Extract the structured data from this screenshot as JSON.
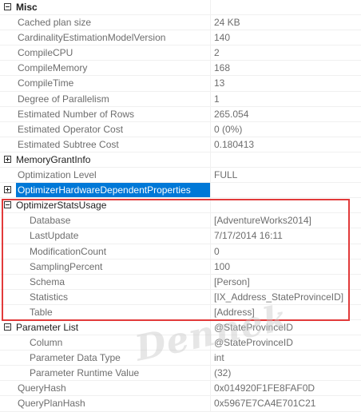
{
  "watermark": "Dennek",
  "rows": [
    {
      "kind": "category",
      "toggle": "minus",
      "name": "Misc",
      "value": ""
    },
    {
      "kind": "prop",
      "name": "Cached plan size",
      "value": "24 KB"
    },
    {
      "kind": "prop",
      "name": "CardinalityEstimationModelVersion",
      "value": "140"
    },
    {
      "kind": "prop",
      "name": "CompileCPU",
      "value": "2"
    },
    {
      "kind": "prop",
      "name": "CompileMemory",
      "value": "168"
    },
    {
      "kind": "prop",
      "name": "CompileTime",
      "value": "13"
    },
    {
      "kind": "prop",
      "name": "Degree of Parallelism",
      "value": "1"
    },
    {
      "kind": "prop",
      "name": "Estimated Number of Rows",
      "value": "265.054"
    },
    {
      "kind": "prop",
      "name": "Estimated Operator Cost",
      "value": "0 (0%)"
    },
    {
      "kind": "prop",
      "name": "Estimated Subtree Cost",
      "value": "0.180413"
    },
    {
      "kind": "group",
      "toggle": "plus",
      "name": "MemoryGrantInfo",
      "value": ""
    },
    {
      "kind": "prop",
      "name": "Optimization Level",
      "value": "FULL"
    },
    {
      "kind": "group",
      "toggle": "plus",
      "name": "OptimizerHardwareDependentProperties",
      "value": "",
      "selected": true
    },
    {
      "kind": "group",
      "toggle": "minus",
      "name": "OptimizerStatsUsage",
      "value": ""
    },
    {
      "kind": "child",
      "name": "Database",
      "value": "[AdventureWorks2014]"
    },
    {
      "kind": "child",
      "name": "LastUpdate",
      "value": "7/17/2014 16:11"
    },
    {
      "kind": "child",
      "name": "ModificationCount",
      "value": "0"
    },
    {
      "kind": "child",
      "name": "SamplingPercent",
      "value": "100"
    },
    {
      "kind": "child",
      "name": "Schema",
      "value": "[Person]"
    },
    {
      "kind": "child",
      "name": "Statistics",
      "value": "[IX_Address_StateProvinceID]"
    },
    {
      "kind": "child",
      "name": "Table",
      "value": "[Address]"
    },
    {
      "kind": "group",
      "toggle": "minus",
      "name": "Parameter List",
      "value": "@StateProvinceID"
    },
    {
      "kind": "child",
      "name": "Column",
      "value": "@StateProvinceID"
    },
    {
      "kind": "child",
      "name": "Parameter Data Type",
      "value": "int"
    },
    {
      "kind": "child",
      "name": "Parameter Runtime Value",
      "value": "(32)"
    },
    {
      "kind": "prop",
      "name": "QueryHash",
      "value": "0x014920F1FE8FAF0D"
    },
    {
      "kind": "prop",
      "name": "QueryPlanHash",
      "value": "0x5967E7CA4E701C21"
    }
  ],
  "colors": {
    "selection": "#0078d7",
    "highlight_border": "#e23a3a"
  }
}
